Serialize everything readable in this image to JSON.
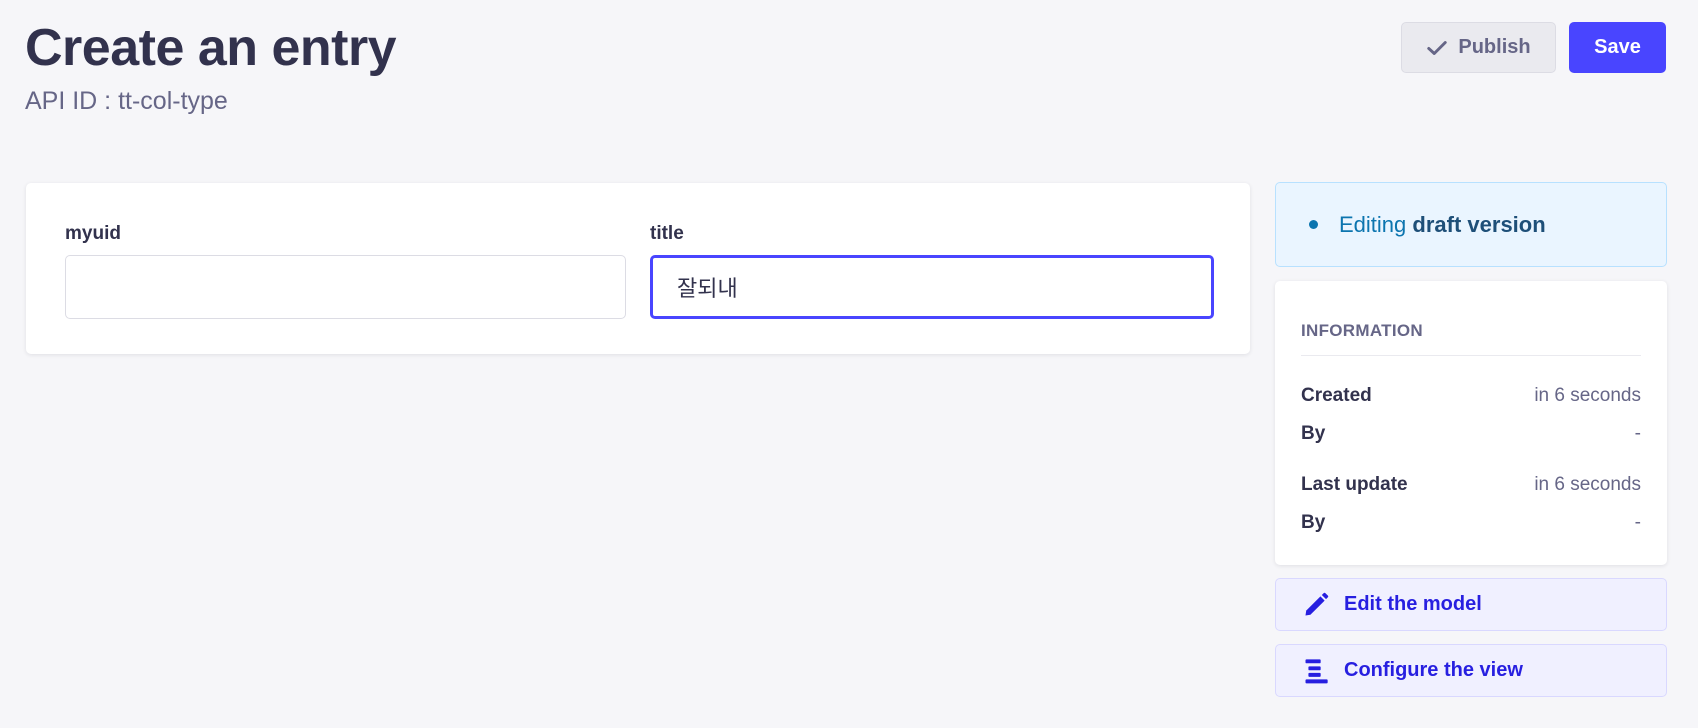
{
  "header": {
    "title": "Create an entry",
    "subtitle": "API ID : tt-col-type"
  },
  "actions": {
    "publish_label": "Publish",
    "save_label": "Save"
  },
  "form": {
    "fields": [
      {
        "label": "myuid",
        "value": ""
      },
      {
        "label": "title",
        "value": "잘되내"
      }
    ]
  },
  "sidebar": {
    "status_prefix": "Editing",
    "status_version": "draft version",
    "information": {
      "heading": "INFORMATION",
      "created_label": "Created",
      "created_value": "in 6 seconds",
      "created_by_label": "By",
      "created_by_value": "-",
      "updated_label": "Last update",
      "updated_value": "in 6 seconds",
      "updated_by_label": "By",
      "updated_by_value": "-"
    },
    "links": {
      "edit_model": "Edit the model",
      "configure_view": "Configure the view"
    }
  },
  "colors": {
    "primary": "#4945ff",
    "link": "#271fe0",
    "draft": "#0c75af"
  },
  "icons": [
    "check-icon",
    "pencil-icon",
    "layout-lines-icon"
  ]
}
